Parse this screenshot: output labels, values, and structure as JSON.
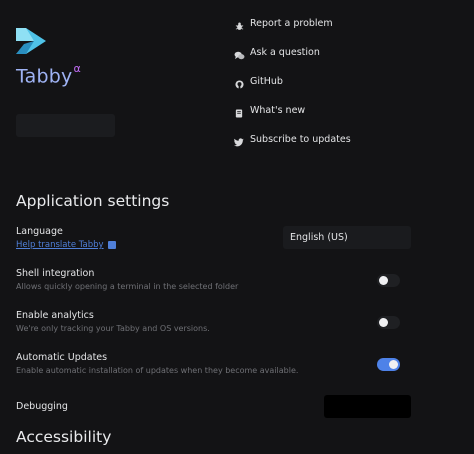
{
  "app": {
    "name": "Tabby",
    "channel": "α"
  },
  "links": [
    {
      "label": "Report a problem",
      "icon": "bug-icon"
    },
    {
      "label": "Ask a question",
      "icon": "chat-bubbles-icon"
    },
    {
      "label": "GitHub",
      "icon": "github-icon"
    },
    {
      "label": "What's new",
      "icon": "book-icon"
    },
    {
      "label": "Subscribe to updates",
      "icon": "twitter-icon"
    }
  ],
  "application_settings": {
    "title": "Application settings",
    "language": {
      "label": "Language",
      "help_link": "Help translate Tabby",
      "value": "English (US)"
    },
    "shell_integration": {
      "label": "Shell integration",
      "description": "Allows quickly opening a terminal in the selected folder",
      "enabled": false
    },
    "analytics": {
      "label": "Enable analytics",
      "description": "We're only tracking your Tabby and OS versions.",
      "enabled": false
    },
    "automatic_updates": {
      "label": "Automatic Updates",
      "description": "Enable automatic installation of updates when they become available.",
      "enabled": true
    },
    "debugging": {
      "label": "Debugging"
    }
  },
  "accessibility": {
    "title": "Accessibility"
  },
  "colors": {
    "background": "#131315",
    "accent": "#4e82e8",
    "app_name": "#9fb3f4",
    "channel": "#c06cf3",
    "link": "#4f7fd8"
  }
}
